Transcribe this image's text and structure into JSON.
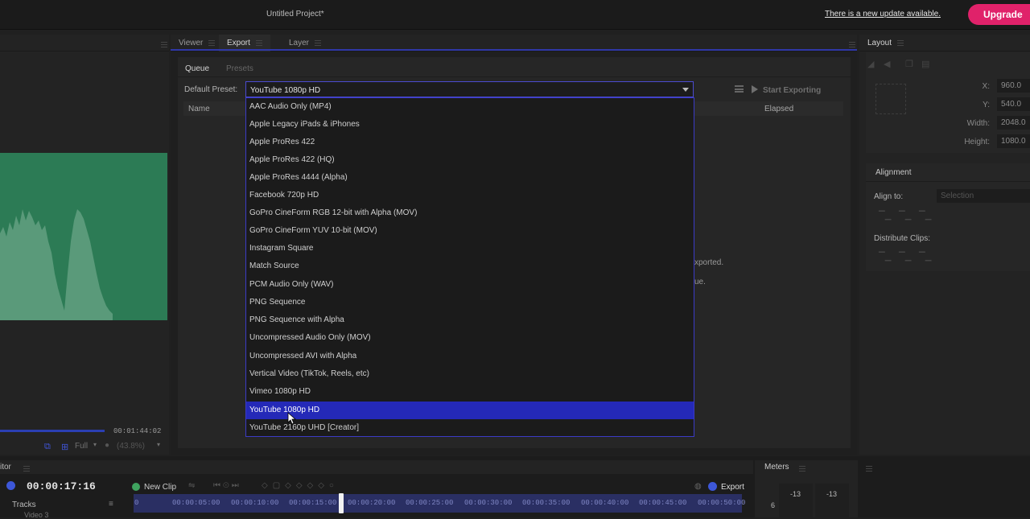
{
  "app": {
    "title": "Untitled Project*",
    "update_notice": "There is a new update available.",
    "upgrade_label": "Upgrade",
    "accent_color": "#2429b8",
    "upgrade_color": "#e0226a"
  },
  "center_tabs": [
    "Viewer",
    "Export",
    "Layer"
  ],
  "export": {
    "subtabs": [
      "Queue",
      "Presets"
    ],
    "default_preset_label": "Default Preset:",
    "default_preset_value": "YouTube 1080p HD",
    "start_exporting_label": "Start Exporting",
    "columns": [
      "Name",
      "Elapsed"
    ],
    "hint_line1_fragment": "xported.",
    "hint_line2_fragment": "ue.",
    "preset_options": [
      "AAC Audio Only (MP4)",
      "Apple Legacy iPads & iPhones",
      "Apple ProRes 422",
      "Apple ProRes 422 (HQ)",
      "Apple ProRes 4444 (Alpha)",
      "Facebook 720p HD",
      "GoPro CineForm RGB 12-bit with Alpha (MOV)",
      "GoPro CineForm YUV 10-bit (MOV)",
      "Instagram Square",
      "Match Source",
      "PCM Audio Only (WAV)",
      "PNG Sequence",
      "PNG Sequence with Alpha",
      "Uncompressed Audio Only (MOV)",
      "Uncompressed AVI with Alpha",
      "Vertical Video (TikTok, Reels, etc)",
      "Vimeo 1080p HD",
      "YouTube 1080p HD",
      "YouTube 2160p UHD [Creator]"
    ],
    "selected_option": "YouTube 1080p HD"
  },
  "viewer_left": {
    "duration": "00:01:44:02",
    "quality": "Full",
    "zoom": "(43.8%)"
  },
  "layout_panel": {
    "title": "Layout",
    "fields": [
      {
        "label": "X:",
        "value": "960.0"
      },
      {
        "label": "Y:",
        "value": "540.0"
      },
      {
        "label": "Width:",
        "value": "2048.0"
      },
      {
        "label": "Height:",
        "value": "1080.0"
      }
    ],
    "alignment_title": "Alignment",
    "align_to_label": "Align to:",
    "align_to_value": "Selection",
    "distribute_label": "Distribute Clips:"
  },
  "editor": {
    "panel_label": "itor",
    "timecode": "00:00:17:16",
    "new_clip_label": "New Clip",
    "export_label": "Export",
    "tracks_label": "Tracks",
    "track_name_fragment": "Video 3",
    "ruler_ticks": [
      "0",
      "00:00:05:00",
      "00:00:10:00",
      "00:00:15:00",
      "00:00:20:00",
      "00:00:25:00",
      "00:00:30:00",
      "00:00:35:00",
      "00:00:40:00",
      "00:00:45:00",
      "00:00:50:00"
    ]
  },
  "meters": {
    "title": "Meters",
    "left_value": "-13",
    "right_value": "-13",
    "scale_value": "6"
  }
}
